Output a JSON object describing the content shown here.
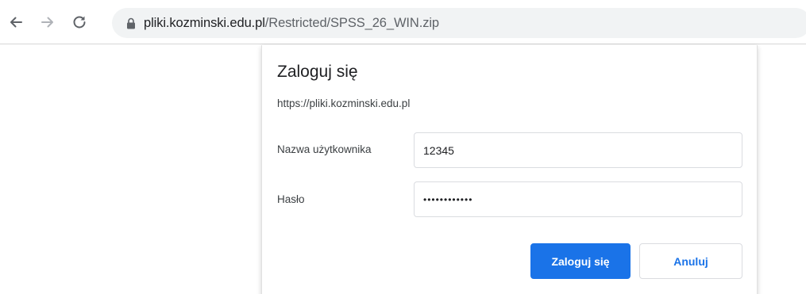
{
  "browser": {
    "url_host": "pliki.kozminski.edu.pl",
    "url_path": "/Restricted/SPSS_26_WIN.zip",
    "icons": {
      "back": "arrow-left-icon",
      "forward": "arrow-right-icon",
      "reload": "reload-icon",
      "lock": "lock-icon"
    }
  },
  "dialog": {
    "title": "Zaloguj się",
    "origin": "https://pliki.kozminski.edu.pl",
    "username_label": "Nazwa użytkownika",
    "username_value": "12345",
    "password_label": "Hasło",
    "password_value": "••••••••••••",
    "login_button": "Zaloguj się",
    "cancel_button": "Anuluj"
  },
  "colors": {
    "accent": "#1a73e8",
    "omnibox_bg": "#f1f3f4",
    "border": "#dadce0"
  }
}
